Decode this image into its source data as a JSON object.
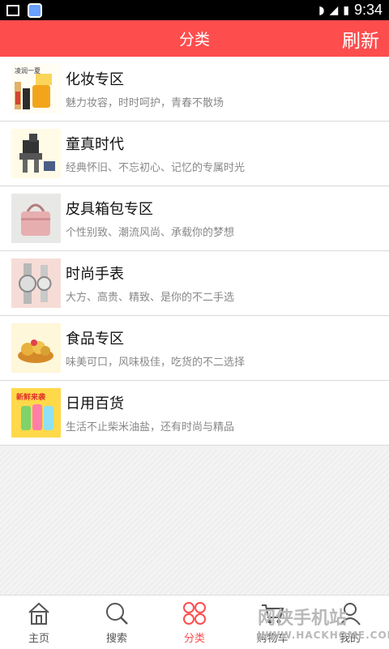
{
  "statusbar": {
    "time": "9:34"
  },
  "header": {
    "title": "分类",
    "refresh_label": "刷新"
  },
  "categories": [
    {
      "title": "化妆专区",
      "subtitle": "魅力妆容，时时呵护，青春不散场",
      "icon": "cosmetics-thumbnail",
      "thumb_text": "凌润一夏"
    },
    {
      "title": "童真时代",
      "subtitle": "经典怀旧、不忘初心、记忆的专属时光",
      "icon": "toy-thumbnail"
    },
    {
      "title": "皮具箱包专区",
      "subtitle": "个性别致、潮流风尚、承载你的梦想",
      "icon": "handbag-thumbnail"
    },
    {
      "title": "时尚手表",
      "subtitle": "大方、高贵、精致、是你的不二手选",
      "icon": "watch-thumbnail"
    },
    {
      "title": "食品专区",
      "subtitle": "味美可口，风味极佳，吃货的不二选择",
      "icon": "food-thumbnail"
    },
    {
      "title": "日用百货",
      "subtitle": "生活不止柴米油盐，还有时尚与精品",
      "icon": "juicer-thumbnail",
      "thumb_text": "新鲜来袭"
    }
  ],
  "tabs": [
    {
      "label": "主页",
      "icon": "home-icon"
    },
    {
      "label": "搜索",
      "icon": "search-icon"
    },
    {
      "label": "分类",
      "icon": "category-icon",
      "active": true
    },
    {
      "label": "购物车",
      "icon": "cart-icon"
    },
    {
      "label": "我的",
      "icon": "user-icon"
    }
  ],
  "watermark": {
    "text": "网侠手机站",
    "url": "WWW.HACKHOME.COM"
  },
  "colors": {
    "accent": "#fd4d4d",
    "text": "#111111",
    "subtext": "#888888"
  }
}
